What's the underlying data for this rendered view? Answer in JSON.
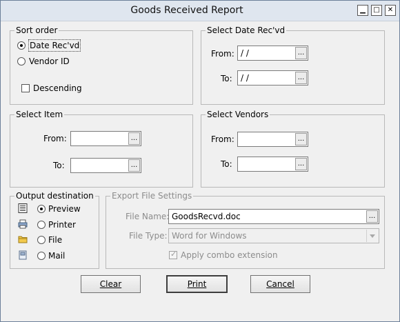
{
  "window": {
    "title": "Goods Received Report",
    "controls": {
      "minimize_glyph": "▁",
      "maximize_glyph": "□",
      "close_glyph": "✕"
    }
  },
  "sort_order": {
    "legend": "Sort order",
    "options": [
      "Date Rec'vd",
      "Vendor ID"
    ],
    "selected": "Date Rec'vd",
    "descending_label": "Descending",
    "descending_checked": false
  },
  "date_range": {
    "legend": "Select Date Rec'vd",
    "from_label": "From:",
    "from_value": "/ /",
    "to_label": "To:",
    "to_value": "/ /"
  },
  "item_range": {
    "legend": "Select Item",
    "from_label": "From:",
    "from_value": "",
    "to_label": "To:",
    "to_value": ""
  },
  "vendor_range": {
    "legend": "Select Vendors",
    "from_label": "From:",
    "from_value": "",
    "to_label": "To:",
    "to_value": ""
  },
  "output": {
    "legend": "Output destination",
    "options": [
      {
        "label": "Preview",
        "icon": "preview-icon"
      },
      {
        "label": "Printer",
        "icon": "printer-icon"
      },
      {
        "label": "File",
        "icon": "folder-icon"
      },
      {
        "label": "Mail",
        "icon": "mail-icon"
      }
    ],
    "selected": "Preview"
  },
  "export": {
    "legend": "Export File Settings",
    "file_name_label": "File Name:",
    "file_name_value": "GoodsRecvd.doc",
    "file_type_label": "File Type:",
    "file_type_value": "Word for Windows",
    "apply_combo_label": "Apply combo extension",
    "apply_combo_checked": true
  },
  "buttons": {
    "clear": "Clear",
    "print": "Print",
    "cancel": "Cancel"
  },
  "browse_glyph": "..."
}
